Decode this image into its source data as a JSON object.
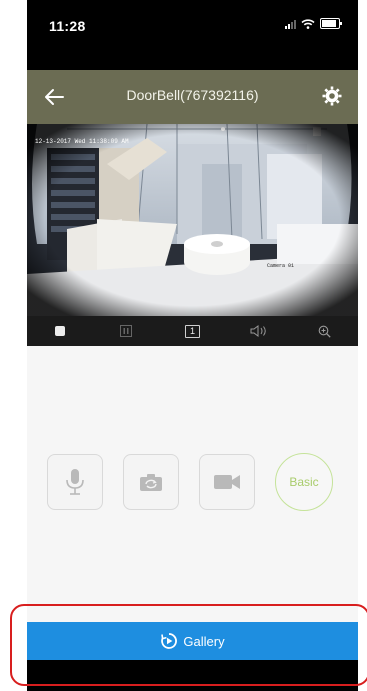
{
  "status_bar": {
    "time": "11:28"
  },
  "nav": {
    "title": "DoorBell(767392116)"
  },
  "video": {
    "timestamp": "12-13-2017 Wed 11:38:09 AM",
    "camera_label": "Camera 01"
  },
  "controls": {
    "ratio_label": "1"
  },
  "actions": {
    "basic_label": "Basic"
  },
  "footer": {
    "gallery_label": "Gallery"
  },
  "colors": {
    "nav_bg": "#6b6c53",
    "gallery_bg": "#1e8ee0",
    "basic_accent": "#a9cc6c",
    "highlight": "#d81e1e"
  }
}
